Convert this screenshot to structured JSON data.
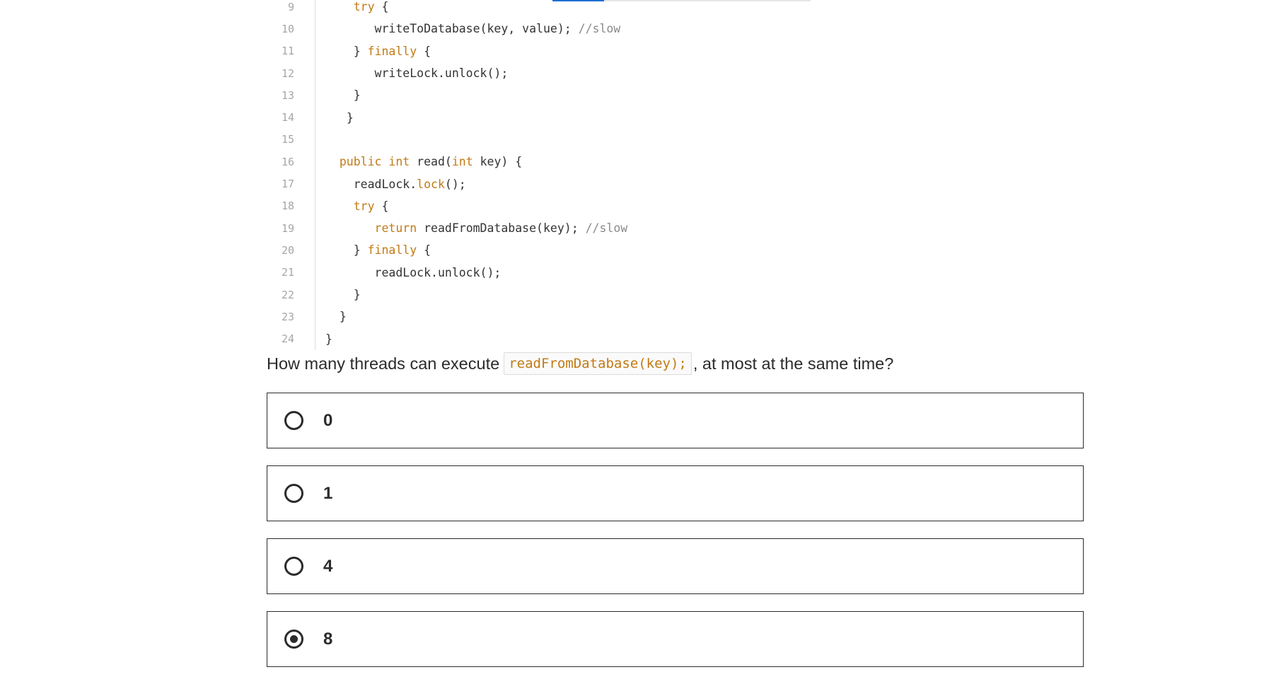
{
  "code": {
    "lines": [
      {
        "number": "9",
        "indent": "    ",
        "tokens": [
          {
            "t": "try",
            "k": "keyword"
          },
          {
            "t": " {",
            "k": "plain"
          }
        ]
      },
      {
        "number": "10",
        "indent": "       ",
        "tokens": [
          {
            "t": "writeToDatabase(key, value); ",
            "k": "plain"
          },
          {
            "t": "//slow",
            "k": "comment"
          }
        ]
      },
      {
        "number": "11",
        "indent": "    ",
        "tokens": [
          {
            "t": "} ",
            "k": "plain"
          },
          {
            "t": "finally",
            "k": "keyword"
          },
          {
            "t": " {",
            "k": "plain"
          }
        ]
      },
      {
        "number": "12",
        "indent": "       ",
        "tokens": [
          {
            "t": "writeLock.unlock();",
            "k": "plain"
          }
        ]
      },
      {
        "number": "13",
        "indent": "    ",
        "tokens": [
          {
            "t": "}",
            "k": "plain"
          }
        ]
      },
      {
        "number": "14",
        "indent": "   ",
        "tokens": [
          {
            "t": "}",
            "k": "plain"
          }
        ]
      },
      {
        "number": "15",
        "indent": "",
        "tokens": []
      },
      {
        "number": "16",
        "indent": "  ",
        "tokens": [
          {
            "t": "public",
            "k": "keyword"
          },
          {
            "t": " ",
            "k": "plain"
          },
          {
            "t": "int",
            "k": "keyword"
          },
          {
            "t": " read(",
            "k": "plain"
          },
          {
            "t": "int",
            "k": "keyword"
          },
          {
            "t": " key) {",
            "k": "plain"
          }
        ]
      },
      {
        "number": "17",
        "indent": "    ",
        "tokens": [
          {
            "t": "readLock.",
            "k": "plain"
          },
          {
            "t": "lock",
            "k": "keyword"
          },
          {
            "t": "();",
            "k": "plain"
          }
        ]
      },
      {
        "number": "18",
        "indent": "    ",
        "tokens": [
          {
            "t": "try",
            "k": "keyword"
          },
          {
            "t": " {",
            "k": "plain"
          }
        ]
      },
      {
        "number": "19",
        "indent": "       ",
        "tokens": [
          {
            "t": "return",
            "k": "keyword"
          },
          {
            "t": " readFromDatabase(key); ",
            "k": "plain"
          },
          {
            "t": "//slow",
            "k": "comment"
          }
        ]
      },
      {
        "number": "20",
        "indent": "    ",
        "tokens": [
          {
            "t": "} ",
            "k": "plain"
          },
          {
            "t": "finally",
            "k": "keyword"
          },
          {
            "t": " {",
            "k": "plain"
          }
        ]
      },
      {
        "number": "21",
        "indent": "       ",
        "tokens": [
          {
            "t": "readLock.unlock();",
            "k": "plain"
          }
        ]
      },
      {
        "number": "22",
        "indent": "    ",
        "tokens": [
          {
            "t": "}",
            "k": "plain"
          }
        ]
      },
      {
        "number": "23",
        "indent": "  ",
        "tokens": [
          {
            "t": "}",
            "k": "plain"
          }
        ]
      },
      {
        "number": "24",
        "indent": "",
        "tokens": [
          {
            "t": "}",
            "k": "plain"
          }
        ]
      }
    ]
  },
  "question": {
    "prefix": "How many threads can execute",
    "code": "readFromDatabase(key);",
    "suffix": ", at most at the same time?"
  },
  "options": [
    {
      "label": "0",
      "selected": false
    },
    {
      "label": "1",
      "selected": false
    },
    {
      "label": "4",
      "selected": false
    },
    {
      "label": "8",
      "selected": true
    }
  ],
  "progress": {
    "fraction": 0.2
  },
  "colors": {
    "keyword": "#c27a14",
    "comment": "#8a8a8a",
    "accent": "#1f6fd1",
    "text": "#2b2b2b"
  }
}
